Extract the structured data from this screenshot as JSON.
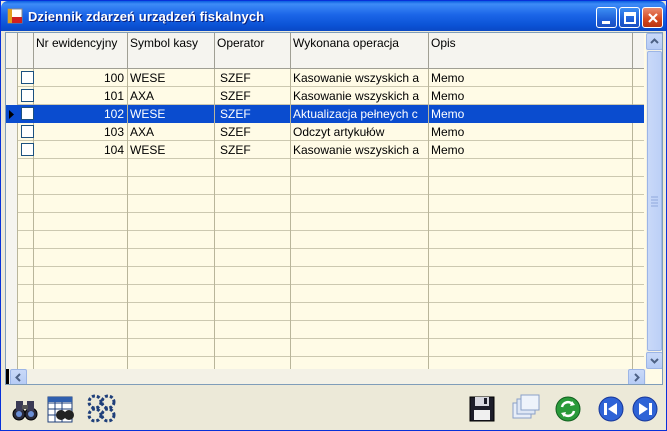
{
  "window": {
    "title": "Dziennik zdarzeń urządzeń fiskalnych"
  },
  "grid": {
    "columns": [
      {
        "label": "Nr ewidencyjny"
      },
      {
        "label": "Symbol kasy"
      },
      {
        "label": "Operator"
      },
      {
        "label": "Wykonana operacja"
      },
      {
        "label": "Opis"
      }
    ],
    "rows": [
      {
        "nr": "100",
        "symbol": "WESE",
        "operator": "SZEF",
        "operacja": "Kasowanie wszyskich a",
        "opis": "Memo"
      },
      {
        "nr": "101",
        "symbol": "AXA",
        "operator": "SZEF",
        "operacja": "Kasowanie wszyskich a",
        "opis": "Memo"
      },
      {
        "nr": "102",
        "symbol": "WESE",
        "operator": "SZEF",
        "operacja": "Aktualizacja pełneych c",
        "opis": "Memo"
      },
      {
        "nr": "103",
        "symbol": "AXA",
        "operator": "SZEF",
        "operacja": "Odczyt artykułów",
        "opis": "Memo"
      },
      {
        "nr": "104",
        "symbol": "WESE",
        "operator": "SZEF",
        "operacja": "Kasowanie wszyskich a",
        "opis": "Memo"
      }
    ],
    "selected_row_index": 2
  },
  "toolbar": {
    "icons": [
      "binoculars-icon",
      "grid-filter-icon",
      "gears-icon",
      "save-icon",
      "windows-icon",
      "refresh-icon",
      "prev-icon",
      "next-icon"
    ]
  },
  "colors": {
    "selection": "#0a4ccf",
    "grid_background": "#fffbe6",
    "titlebar": "#0b53d6"
  }
}
